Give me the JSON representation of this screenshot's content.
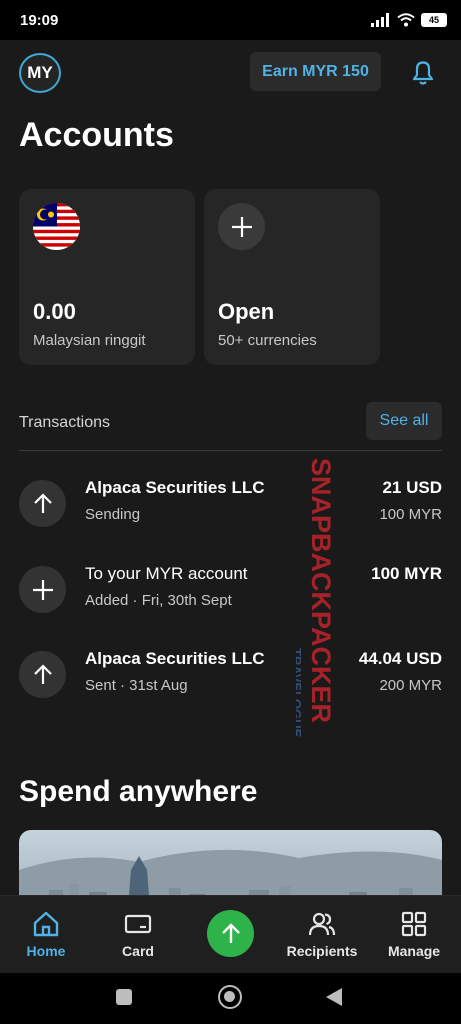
{
  "status_bar": {
    "time": "19:09",
    "battery": "45"
  },
  "header": {
    "avatar_initials": "MY",
    "earn_label": "Earn MYR 150"
  },
  "page_title": "Accounts",
  "accounts": [
    {
      "amount": "0.00",
      "subtitle": "Malaysian ringgit",
      "icon": "malaysia-flag"
    },
    {
      "amount": "Open",
      "subtitle": "50+ currencies",
      "icon": "plus-icon"
    }
  ],
  "transactions_section": {
    "title": "Transactions",
    "see_all_label": "See all"
  },
  "transactions": [
    {
      "title": "Alpaca Securities LLC",
      "subtitle": "Sending",
      "amount": "21 USD",
      "amount_secondary": "100 MYR",
      "icon": "arrow-up-icon"
    },
    {
      "title": "To your MYR account",
      "subtitle": "Added · Fri, 30th Sept",
      "amount": "100 MYR",
      "amount_secondary": "",
      "icon": "plus-icon"
    },
    {
      "title": "Alpaca Securities LLC",
      "subtitle": "Sent · 31st Aug",
      "amount": "44.04 USD",
      "amount_secondary": "200 MYR",
      "icon": "arrow-up-icon"
    }
  ],
  "spend_section": {
    "title": "Spend anywhere"
  },
  "watermark": {
    "brand": "SNAPBACKPACKER",
    "tagline": "TRAVELOGUE"
  },
  "bottom_nav": {
    "home": "Home",
    "card": "Card",
    "recipients": "Recipients",
    "manage": "Manage"
  },
  "colors": {
    "accent": "#4fb3e6",
    "send": "#2eb24a",
    "background": "#1a1a1a",
    "card": "#262626",
    "watermark": "#c0242b"
  }
}
